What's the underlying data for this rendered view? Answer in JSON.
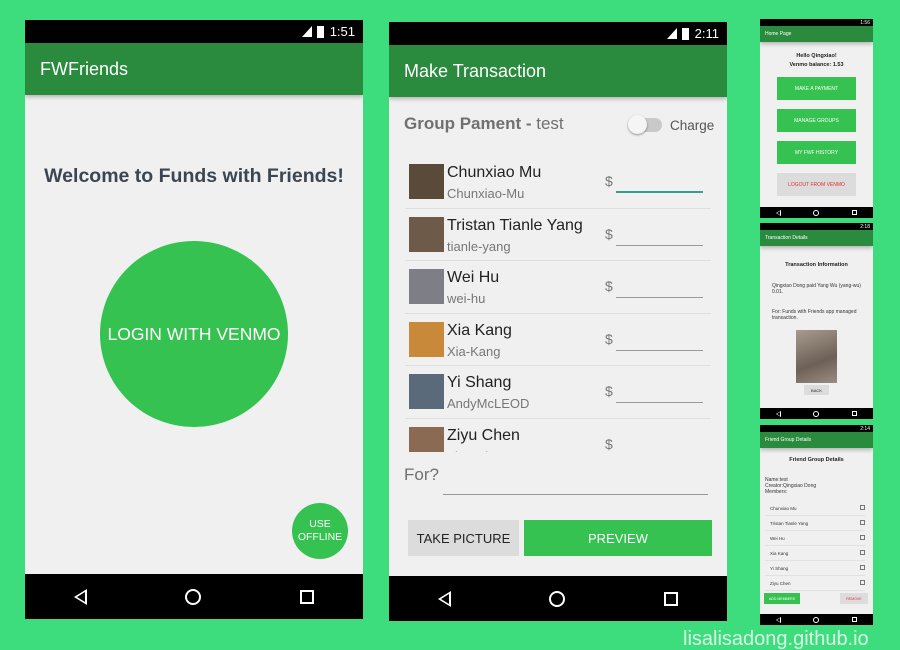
{
  "phone1": {
    "status_time": "1:51",
    "network": "3G",
    "app_title": "FWFriends",
    "welcome": "Welcome to Funds with Friends!",
    "login_button": "LOGIN WITH VENMO",
    "offline_line1": "USE",
    "offline_line2": "OFFLINE"
  },
  "phone2": {
    "status_time": "2:11",
    "network": "3G",
    "app_title": "Make Transaction",
    "group_label": "Group Pament - ",
    "group_name": "test",
    "charge_label": "Charge",
    "charge_on": false,
    "friends": [
      {
        "name": "Chunxiao Mu",
        "username": "Chunxiao-Mu",
        "amount": ""
      },
      {
        "name": "Tristan Tianle Yang",
        "username": "tianle-yang",
        "amount": ""
      },
      {
        "name": "Wei Hu",
        "username": "wei-hu",
        "amount": ""
      },
      {
        "name": "Xia Kang",
        "username": "Xia-Kang",
        "amount": ""
      },
      {
        "name": "Yi Shang",
        "username": "AndyMcLEOD",
        "amount": ""
      },
      {
        "name": "Ziyu Chen",
        "username": "Ziyu-Chen",
        "amount": ""
      }
    ],
    "currency": "$",
    "for_label": "For?",
    "take_picture": "TAKE PICTURE",
    "preview": "PREVIEW"
  },
  "small1": {
    "status_time": "1:56",
    "app_title": "Home Page",
    "greeting": "Hello Qingxiao!",
    "balance": "Venmo balance: 1.53",
    "buttons": [
      "MAKE A PAYMENT",
      "MANAGE GROUPS",
      "MY FWF HISTORY",
      "LOGOUT FROM VENMO"
    ]
  },
  "small2": {
    "status_time": "2:18",
    "app_title": "Transaction Details",
    "heading": "Transaction Information",
    "line1": "Qingxiao Dong paid Yang Wu (yang-wu) 0.01.",
    "line2": "For: Funds with Friends app managed transaction.",
    "back": "BACK"
  },
  "small3": {
    "status_time": "2:14",
    "app_title": "Friend Group Details",
    "heading": "Friend Group Details",
    "name_line": "Name:test",
    "creator_line": "Creator:Qingxiao Dong",
    "members_label": "Members:",
    "members": [
      "Chunxiao Mu",
      "Tristan Tianle Yang",
      "Wei Hu",
      "Xia Kang",
      "Yi Shang",
      "Ziyu Chen"
    ],
    "add_members": "ADD MEMBERS",
    "remove": "REMOVE"
  },
  "watermark": "lisalisadong.github.io",
  "colors": {
    "background": "#3ddc7d",
    "appbar": "#2a8a3e",
    "accent": "#36c250"
  }
}
